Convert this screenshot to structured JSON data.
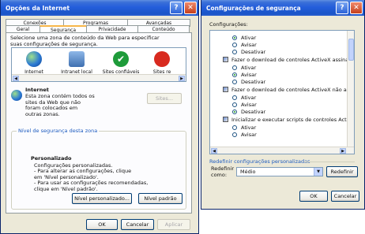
{
  "left_window": {
    "title": "Opções da Internet",
    "tabs_row1": [
      "Conexões",
      "Programas",
      "Avançadas"
    ],
    "tabs_row2": [
      "Geral",
      "Segurança",
      "Privacidade",
      "Conteúdo"
    ],
    "instructions": "Selecione uma zona de conteúdo da Web para especificar suas configurações de segurança.",
    "zones": [
      {
        "label": "Internet",
        "icon": "globe-icon"
      },
      {
        "label": "Intranet local",
        "icon": "intranet-icon"
      },
      {
        "label": "Sites confiáveis",
        "icon": "check-icon"
      },
      {
        "label": "Sites re",
        "icon": "restricted-icon"
      }
    ],
    "zone_desc_title": "Internet",
    "zone_desc_text": "Esta zona contém todos os sites da Web que não foram colocados em outras zonas.",
    "sites_button": "Sites...",
    "group_title": "Nível de segurança desta zona",
    "custom_title": "Personalizado",
    "custom_text1": "Configurações personalizadas.",
    "custom_text2": "- Para alterar as configurações, clique em 'Nível personalizado'.",
    "custom_text3": "- Para usar as configurações recomendadas, clique em 'Nível padrão'.",
    "btn_custom_level": "Nível personalizado...",
    "btn_default_level": "Nível padrão",
    "btn_ok": "OK",
    "btn_cancel": "Cancelar",
    "btn_apply": "Aplicar"
  },
  "right_window": {
    "title": "Configurações de segurança",
    "settings_label": "Configurações:",
    "items": [
      {
        "type": "radio",
        "text": "Ativar",
        "checked": true
      },
      {
        "type": "radio",
        "text": "Avisar",
        "checked": false
      },
      {
        "type": "radio",
        "text": "Desativar",
        "checked": false
      },
      {
        "type": "header",
        "text": "Fazer o download de controles ActiveX assinados"
      },
      {
        "type": "radio",
        "text": "Ativar",
        "checked": false
      },
      {
        "type": "radio",
        "text": "Avisar",
        "checked": true
      },
      {
        "type": "radio",
        "text": "Desativar",
        "checked": false
      },
      {
        "type": "header",
        "text": "Fazer o download de controles ActiveX não assinados"
      },
      {
        "type": "radio",
        "text": "Ativar",
        "checked": false
      },
      {
        "type": "radio",
        "text": "Avisar",
        "checked": false
      },
      {
        "type": "radio",
        "text": "Desativar",
        "checked": true
      },
      {
        "type": "header",
        "text": "Inicializar e executar scripts de controles ActiveX não m"
      },
      {
        "type": "radio",
        "text": "Ativar",
        "checked": false
      },
      {
        "type": "radio",
        "text": "Avisar",
        "checked": false
      }
    ],
    "reset_title": "Redefinir configurações personalizadas",
    "reset_label": "Redefinir como:",
    "reset_value": "Médio",
    "btn_reset": "Redefinir",
    "btn_ok": "OK",
    "btn_cancel": "Cancelar"
  }
}
